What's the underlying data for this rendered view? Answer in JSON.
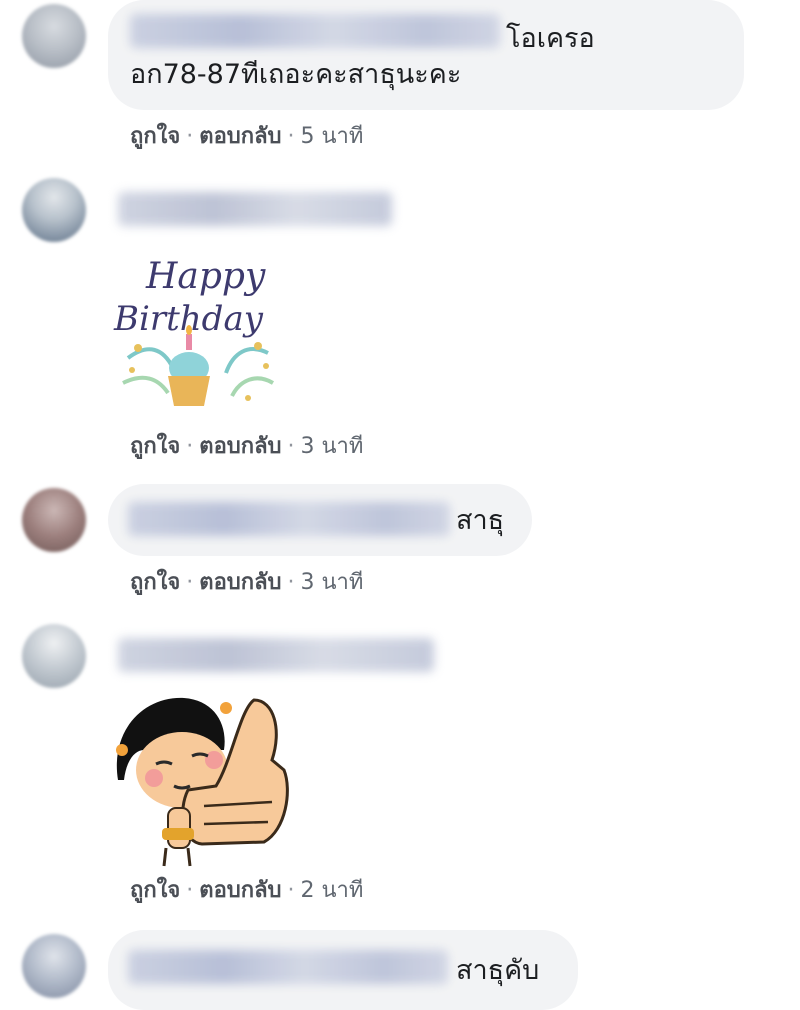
{
  "comments": [
    {
      "text_line1": "โอเครอ",
      "text_line2": "อก78-87ทีเถอะคะสาธุนะคะ",
      "actions": {
        "like": "ถูกใจ",
        "reply": "ตอบกลับ",
        "time": "5 นาที"
      }
    },
    {
      "sticker": {
        "name": "happy-birthday-sticker",
        "text_line1": "Happy",
        "text_line2": "Birthday"
      },
      "actions": {
        "like": "ถูกใจ",
        "reply": "ตอบกลับ",
        "time": "3 นาที"
      }
    },
    {
      "text_line1": "สาธุ",
      "actions": {
        "like": "ถูกใจ",
        "reply": "ตอบกลับ",
        "time": "3 นาที"
      }
    },
    {
      "sticker": {
        "name": "thumbs-up-sticker"
      },
      "actions": {
        "like": "ถูกใจ",
        "reply": "ตอบกลับ",
        "time": "2 นาที"
      }
    },
    {
      "text_line1": "สาธุคับ"
    }
  ],
  "colors": {
    "bubble": "#f2f3f5",
    "action_text": "#4b4f56",
    "separator": "#90949c"
  }
}
